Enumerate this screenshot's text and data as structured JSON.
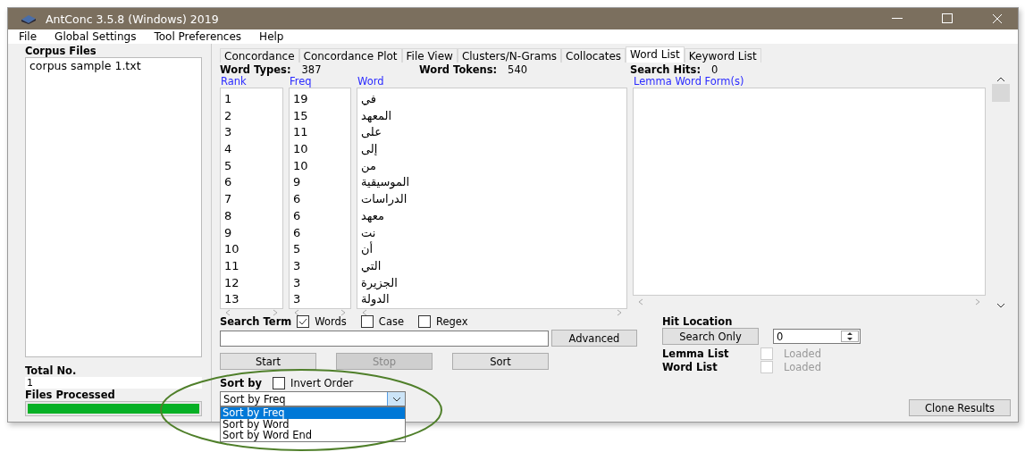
{
  "window": {
    "title": "AntConc 3.5.8 (Windows) 2019"
  },
  "menu": [
    "File",
    "Global Settings",
    "Tool Preferences",
    "Help"
  ],
  "corpus_files": {
    "title": "Corpus Files",
    "files": [
      "corpus sample 1.txt"
    ]
  },
  "total": {
    "label": "Total No.",
    "value": "1"
  },
  "files_processed": {
    "label": "Files Processed",
    "level": 1
  },
  "tabs": [
    {
      "label": "Concordance",
      "selected": false
    },
    {
      "label": "Concordance Plot",
      "selected": false
    },
    {
      "label": "File View",
      "selected": false
    },
    {
      "label": "Clusters/N-Grams",
      "selected": false
    },
    {
      "label": "Collocates",
      "selected": false
    },
    {
      "label": "Word List",
      "selected": true
    },
    {
      "label": "Keyword List",
      "selected": false
    }
  ],
  "stats": [
    {
      "label": "Word Types:",
      "value": "387"
    },
    {
      "label": "Word Tokens:",
      "value": "540"
    },
    {
      "label": "Search Hits:",
      "value": "0"
    }
  ],
  "columns": [
    "Rank",
    "Freq",
    "Word",
    "Lemma Word Form(s)"
  ],
  "rows": [
    {
      "rank": "1",
      "freq": "19",
      "word": "في"
    },
    {
      "rank": "2",
      "freq": "15",
      "word": "المعهد"
    },
    {
      "rank": "3",
      "freq": "11",
      "word": "على"
    },
    {
      "rank": "4",
      "freq": "10",
      "word": "إلى"
    },
    {
      "rank": "5",
      "freq": "10",
      "word": "من"
    },
    {
      "rank": "6",
      "freq": "9",
      "word": "الموسيقية"
    },
    {
      "rank": "7",
      "freq": "6",
      "word": "الدراسات"
    },
    {
      "rank": "8",
      "freq": "6",
      "word": "معهد"
    },
    {
      "rank": "9",
      "freq": "6",
      "word": "نت"
    },
    {
      "rank": "10",
      "freq": "5",
      "word": "أن"
    },
    {
      "rank": "11",
      "freq": "3",
      "word": "التي"
    },
    {
      "rank": "12",
      "freq": "3",
      "word": "الجزيرة"
    },
    {
      "rank": "13",
      "freq": "3",
      "word": "الدولة"
    }
  ],
  "search": {
    "label": "Search Term",
    "options": [
      {
        "label": "Words",
        "checked": true
      },
      {
        "label": "Case",
        "checked": false
      },
      {
        "label": "Regex",
        "checked": false
      }
    ],
    "advanced": "Advanced"
  },
  "actions": [
    {
      "label": "Start",
      "disabled": false
    },
    {
      "label": "Stop",
      "disabled": true
    },
    {
      "label": "Sort",
      "disabled": false
    }
  ],
  "sort_by": {
    "label": "Sort by",
    "invert": {
      "label": "Invert Order",
      "checked": false
    },
    "value": "Sort by Freq",
    "options": [
      {
        "label": "Sort by Freq",
        "selected": true
      },
      {
        "label": "Sort by Word",
        "selected": false
      },
      {
        "label": "Sort by Word End",
        "selected": false
      }
    ]
  },
  "hit_location": {
    "label": "Hit Location",
    "button": "Search Only",
    "value": "0"
  },
  "lists": [
    {
      "label": "Lemma List",
      "loaded": {
        "label": "Loaded",
        "checked": false,
        "disabled": true
      }
    },
    {
      "label": "Word List",
      "loaded": {
        "label": "Loaded",
        "checked": false,
        "disabled": true
      }
    }
  ],
  "clone_button": "Clone Results"
}
